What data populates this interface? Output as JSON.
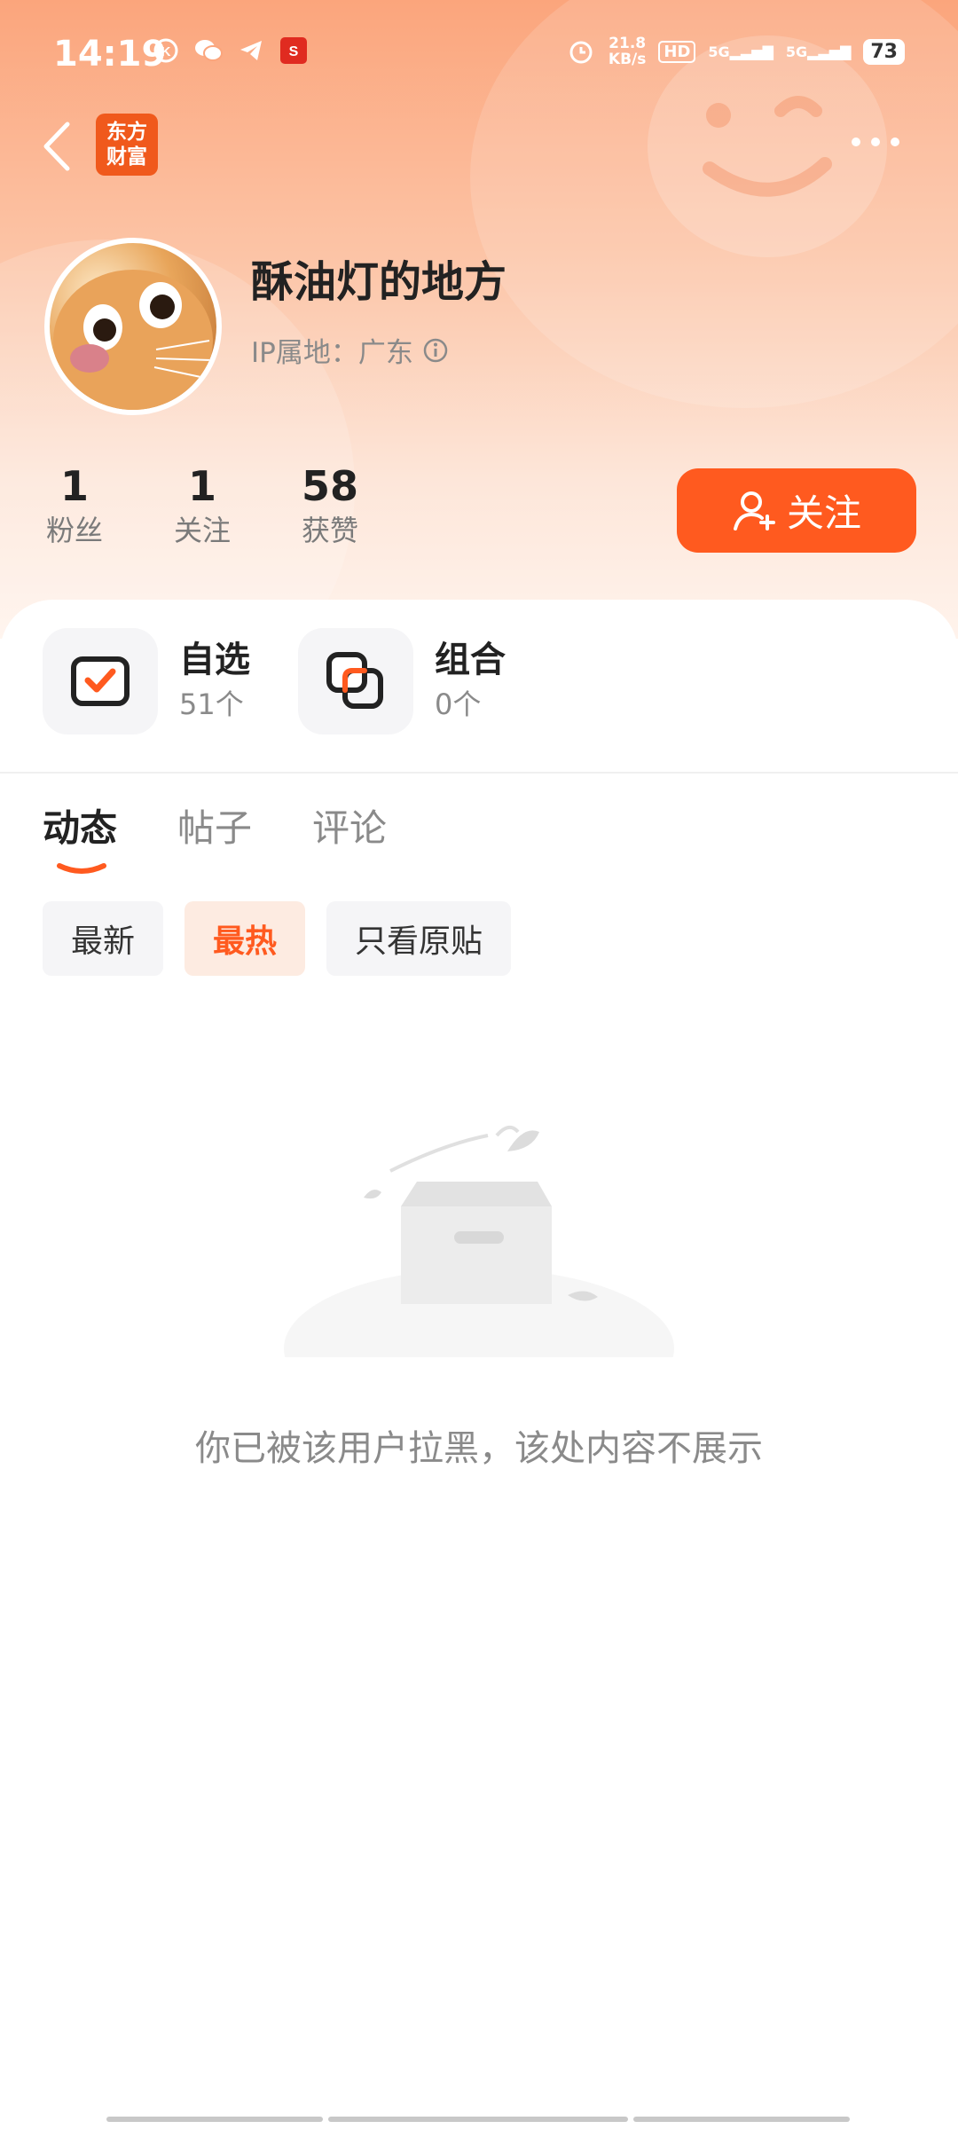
{
  "status_bar": {
    "time": "14:19",
    "speed_value": "21.8",
    "speed_unit": "KB/s",
    "hd_label": "HD",
    "sim1": "5G",
    "sim2": "5G",
    "battery": "73"
  },
  "nav": {
    "app_logo_line1": "东方",
    "app_logo_line2": "财富"
  },
  "profile": {
    "username": "酥油灯的地方",
    "ip_location": "IP属地：广东"
  },
  "stats": [
    {
      "value": "1",
      "label": "粉丝"
    },
    {
      "value": "1",
      "label": "关注"
    },
    {
      "value": "58",
      "label": "获赞"
    }
  ],
  "follow_button": {
    "label": "关注"
  },
  "quick_links": [
    {
      "title": "自选",
      "count": "51个"
    },
    {
      "title": "组合",
      "count": "0个"
    }
  ],
  "tabs": [
    {
      "label": "动态",
      "active": true
    },
    {
      "label": "帖子",
      "active": false
    },
    {
      "label": "评论",
      "active": false
    }
  ],
  "filters": [
    {
      "label": "最新",
      "active": false
    },
    {
      "label": "最热",
      "active": true
    },
    {
      "label": "只看原贴",
      "active": false
    }
  ],
  "empty_state": {
    "message": "你已被该用户拉黑，该处内容不展示"
  },
  "colors": {
    "accent": "#ff5a1f",
    "header_gradient_top": "#fba57c"
  }
}
